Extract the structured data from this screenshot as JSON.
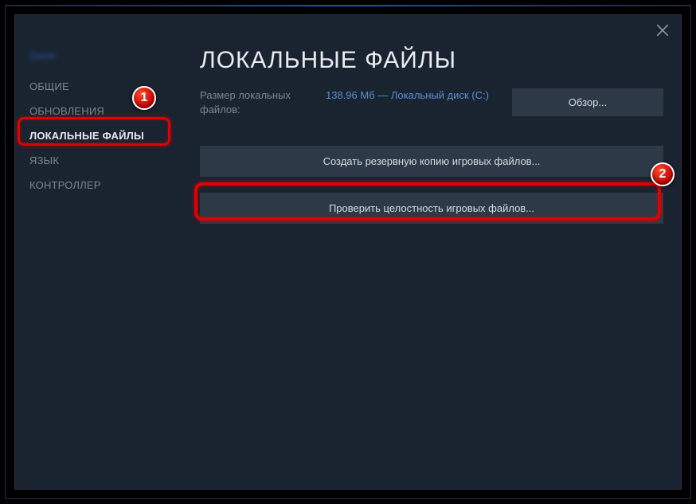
{
  "game_name": "Game",
  "sidebar": {
    "items": [
      {
        "label": "ОБЩИЕ"
      },
      {
        "label": "ОБНОВЛЕНИЯ"
      },
      {
        "label": "ЛОКАЛЬНЫЕ ФАЙЛЫ"
      },
      {
        "label": "ЯЗЫК"
      },
      {
        "label": "КОНТРОЛЛЕР"
      }
    ],
    "activeIndex": 2
  },
  "content": {
    "title": "ЛОКАЛЬНЫЕ ФАЙЛЫ",
    "size_label": "Размер локальных файлов:",
    "size_value": "138.96 Мб — Локальный диск (C:)",
    "browse_label": "Обзор...",
    "backup_button": "Создать резервную копию игровых файлов...",
    "verify_button": "Проверить целостность игровых файлов..."
  },
  "annotations": {
    "badge1_text": "1",
    "badge2_text": "2"
  }
}
